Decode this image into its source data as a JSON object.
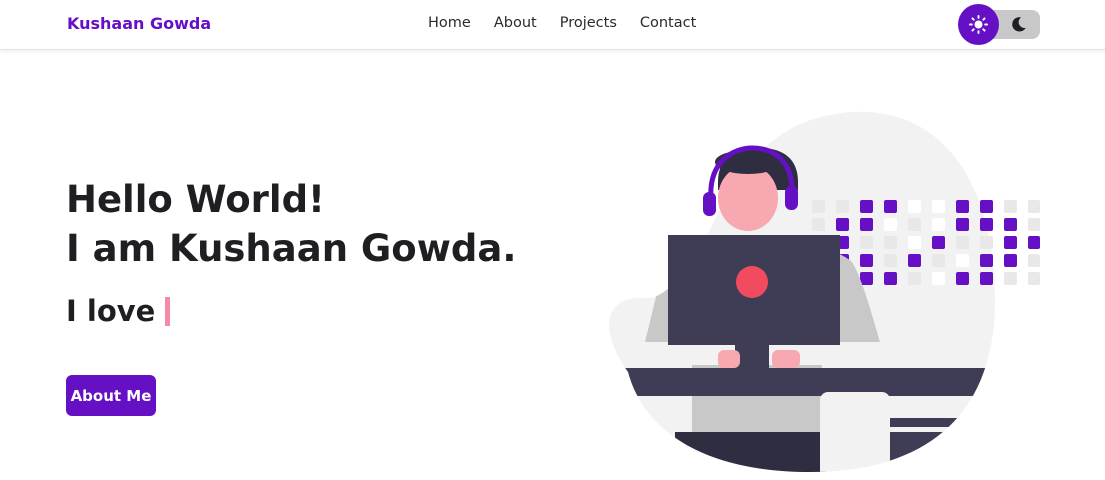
{
  "brand": {
    "name": "Kushaan Gowda"
  },
  "nav": {
    "links": [
      {
        "label": "Home"
      },
      {
        "label": "About"
      },
      {
        "label": "Projects"
      },
      {
        "label": "Contact"
      }
    ]
  },
  "theme_toggle": {
    "light_icon": "sun-icon",
    "dark_icon": "moon-icon",
    "mode": "light"
  },
  "hero": {
    "line1": "Hello World!",
    "line2": "I am Kushaan Gowda.",
    "love_prefix": "I love",
    "cta_label": "About Me"
  },
  "colors": {
    "accent": "#6610c6",
    "text": "#1f1f23",
    "monitor": "#3f3d56",
    "skin": "#f8a8b0",
    "dot": "#f24b5f",
    "cursor": "#f48aa3"
  }
}
